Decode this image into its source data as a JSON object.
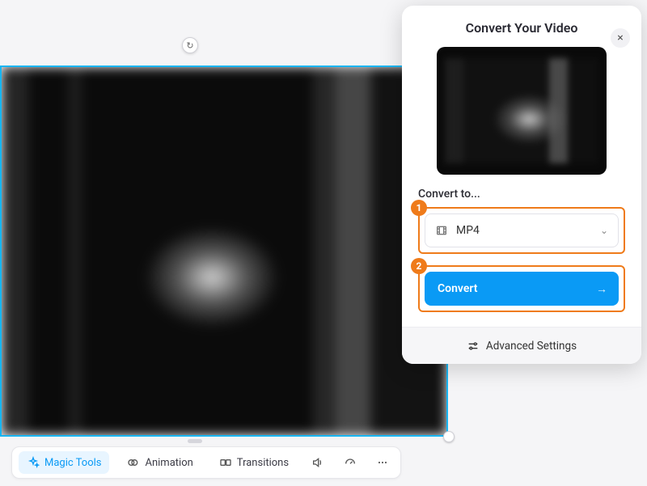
{
  "canvas": {
    "rotate_icon": "↻"
  },
  "toolbar": {
    "magic_tools": "Magic Tools",
    "animation": "Animation",
    "transitions": "Transitions"
  },
  "panel": {
    "title": "Convert Your Video",
    "close": "×",
    "convert_to_label": "Convert to...",
    "step1": "1",
    "step2": "2",
    "format_selected": "MP4",
    "convert_button": "Convert",
    "convert_arrow": "→",
    "advanced_settings": "Advanced Settings"
  }
}
